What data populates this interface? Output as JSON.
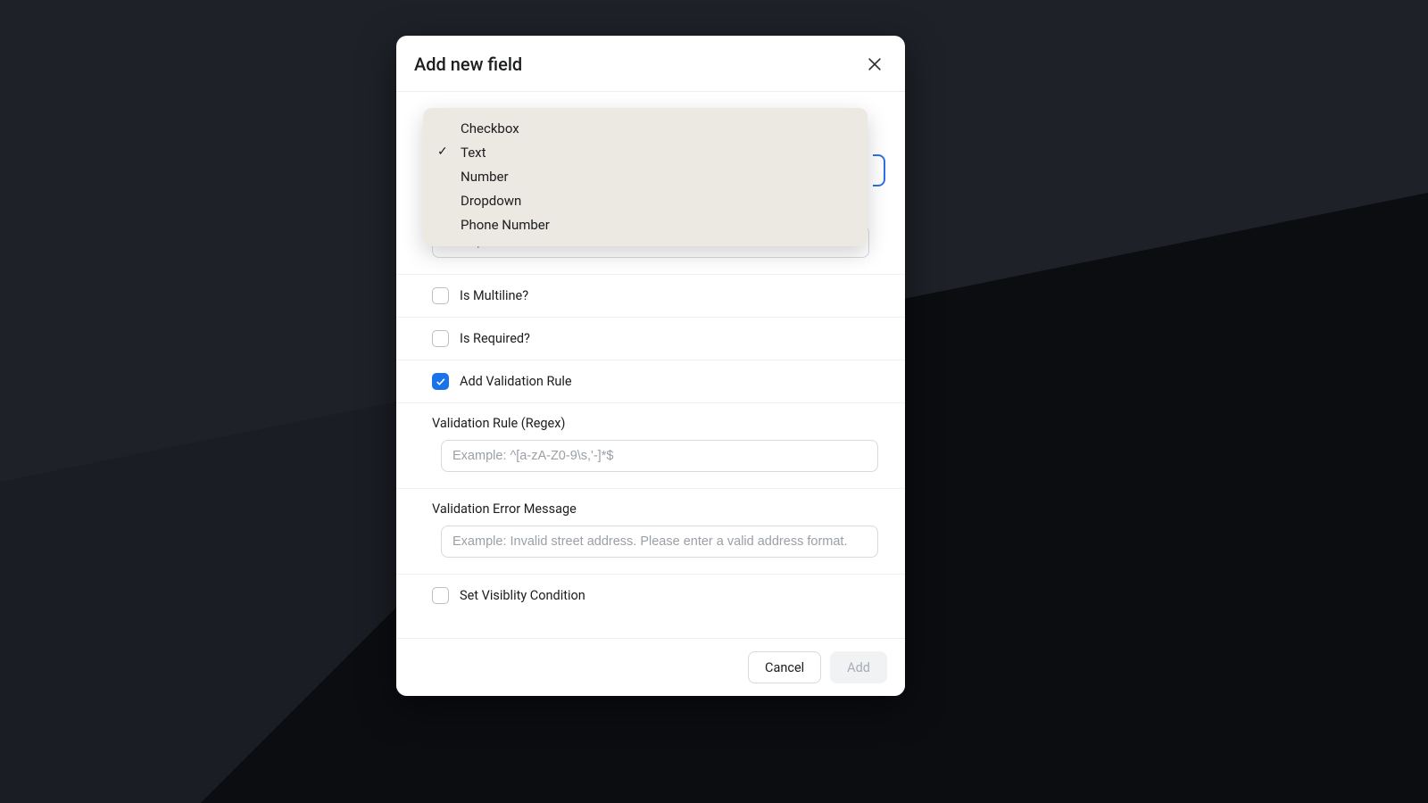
{
  "modal": {
    "title": "Add new field",
    "close_aria": "Close"
  },
  "dropdown": {
    "options": [
      "Checkbox",
      "Text",
      "Number",
      "Dropdown",
      "Phone Number"
    ],
    "selected": "Text"
  },
  "name_field": {
    "placeholder": "Example: Street address",
    "value": ""
  },
  "checkboxes": {
    "is_multiline": {
      "label": "Is Multiline?",
      "checked": false
    },
    "is_required": {
      "label": "Is Required?",
      "checked": false
    },
    "add_validation": {
      "label": "Add Validation Rule",
      "checked": true
    },
    "set_visibility": {
      "label": "Set Visiblity Condition",
      "checked": false
    }
  },
  "validation_rule": {
    "label": "Validation Rule (Regex)",
    "placeholder": "Example: ^[a-zA-Z0-9\\s,'-]*$",
    "value": ""
  },
  "validation_error": {
    "label": "Validation Error Message",
    "placeholder": "Example: Invalid street address. Please enter a valid address format.",
    "value": ""
  },
  "footer": {
    "cancel": "Cancel",
    "add": "Add"
  }
}
